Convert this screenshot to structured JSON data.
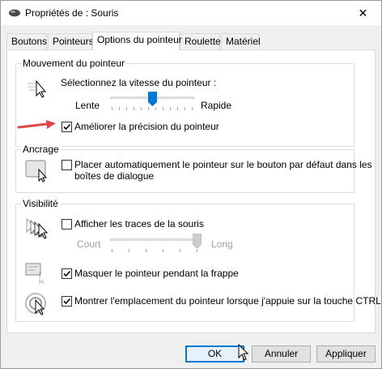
{
  "window": {
    "title": "Propriétés de : Souris",
    "close_glyph": "✕"
  },
  "tabs": [
    {
      "label": "Boutons"
    },
    {
      "label": "Pointeurs"
    },
    {
      "label": "Options du pointeur",
      "active": true
    },
    {
      "label": "Roulette"
    },
    {
      "label": "Matériel"
    }
  ],
  "motion": {
    "label": "Mouvement du pointeur",
    "speed_prompt": "Sélectionnez la vitesse du pointeur :",
    "slow_label": "Lente",
    "fast_label": "Rapide",
    "speed_level": 0.5,
    "precision_label": "Améliorer la précision du pointeur",
    "precision_checked": true
  },
  "snap": {
    "label": "Ancrage",
    "checkbox_label_line1": "Placer automatiquement le pointeur sur le bouton par défaut dans les",
    "checkbox_label_line2": "boîtes de dialogue",
    "checked": false
  },
  "visibility": {
    "label": "Visibilité",
    "trails_label": "Afficher les traces de la souris",
    "trails_checked": false,
    "short_label": "Court",
    "long_label": "Long",
    "trails_level": 1.0,
    "hide_label": "Masquer le pointeur pendant la frappe",
    "hide_checked": true,
    "ctrl_label": "Montrer l'emplacement du pointeur lorsque j'appuie sur la touche CTRL",
    "ctrl_checked": true
  },
  "buttons": {
    "ok": "OK",
    "cancel": "Annuler",
    "apply": "Appliquer"
  },
  "colors": {
    "accent": "#0078d7",
    "annotation_arrow": "#e04848"
  }
}
